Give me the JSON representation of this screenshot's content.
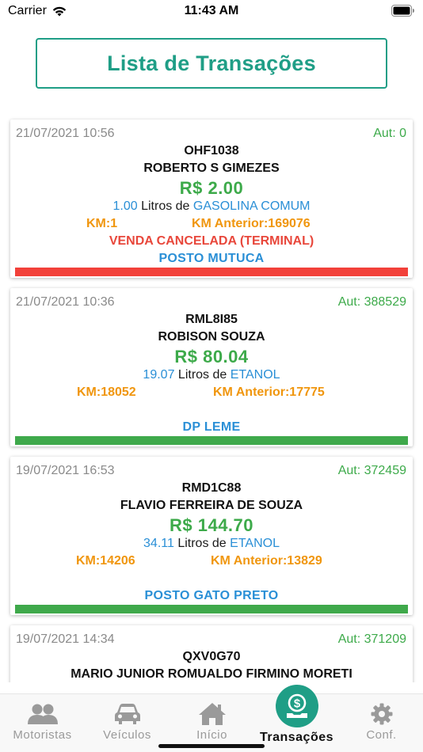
{
  "status": {
    "carrier": "Carrier",
    "time": "11:43 AM"
  },
  "header": {
    "title": "Lista de Transações"
  },
  "transactions": [
    {
      "date": "21/07/2021 10:56",
      "aut": "Aut: 0",
      "plate": "OHF1038",
      "driver": "ROBERTO S GIMEZES",
      "price": "R$ 2.00",
      "liters": "1.00",
      "liters_label": " Litros de ",
      "fuel": "GASOLINA COMUM",
      "km": "KM:1",
      "km_prev": "KM Anterior:169076",
      "canceled": "VENDA CANCELADA (TERMINAL)",
      "station": "POSTO MUTUCA",
      "status_color": "#f2413a"
    },
    {
      "date": "21/07/2021 10:36",
      "aut": "Aut: 388529",
      "plate": "RML8I85",
      "driver": "ROBISON  SOUZA",
      "price": "R$ 80.04",
      "liters": "19.07",
      "liters_label": " Litros de ",
      "fuel": "ETANOL",
      "km": "KM:18052",
      "km_prev": "KM Anterior:17775",
      "canceled": "",
      "station": "DP LEME",
      "status_color": "#3fa94b"
    },
    {
      "date": "19/07/2021 16:53",
      "aut": "Aut: 372459",
      "plate": "RMD1C88",
      "driver": "FLAVIO FERREIRA DE SOUZA",
      "price": "R$ 144.70",
      "liters": "34.11",
      "liters_label": " Litros de ",
      "fuel": "ETANOL",
      "km": "KM:14206",
      "km_prev": "KM Anterior:13829",
      "canceled": "",
      "station": "POSTO GATO PRETO",
      "status_color": "#3fa94b"
    },
    {
      "date": "19/07/2021 14:34",
      "aut": "Aut: 371209",
      "plate": "QXV0G70",
      "driver": "MARIO JUNIOR ROMUALDO FIRMINO MORETI"
    }
  ],
  "tabbar": {
    "items": [
      {
        "label": "Motoristas",
        "icon": "users-icon"
      },
      {
        "label": "Veículos",
        "icon": "car-icon"
      },
      {
        "label": "Início",
        "icon": "home-icon"
      },
      {
        "label": "Transações",
        "icon": "money-hand-icon"
      },
      {
        "label": "Conf.",
        "icon": "gear-icon"
      }
    ],
    "active_color": "#1f9e86"
  }
}
